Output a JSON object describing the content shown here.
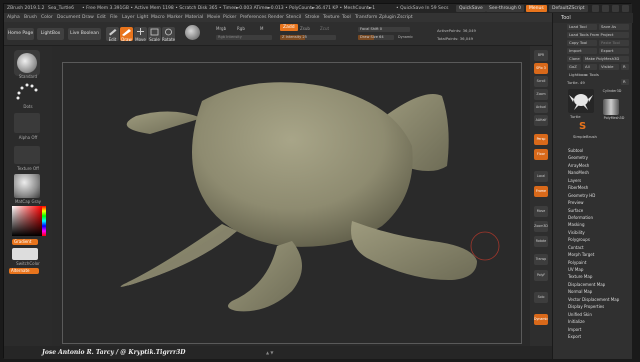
{
  "titlebar": {
    "app": "ZBrush 2019.1.2",
    "doc": "Sea_Turtle6",
    "stats": "• Free Mem 3.391GB • Active Mem 1198 • Scratch Disk 365 • Timer►0.003 ATime►0.013 • PolyCount►36.471 KP • MeshCount►1",
    "quicksave_info": "• QuickSave In 59 Secs",
    "quicksave": "QuickSave",
    "seethrough": "See-through 0",
    "menus": "Menus",
    "script": "DefaultZScript"
  },
  "menubar": [
    "Alpha",
    "Brush",
    "Color",
    "Document",
    "Draw",
    "Edit",
    "File",
    "Layer",
    "Light",
    "Macro",
    "Marker",
    "Material",
    "Movie",
    "Picker",
    "Preferences",
    "Render",
    "Stencil",
    "Stroke",
    "Texture",
    "Tool",
    "Transform",
    "Zplugin",
    "Zscript"
  ],
  "shelf": {
    "home_page": "Home Page",
    "lightbox": "LightBox",
    "live_boolean": "Live Boolean",
    "edit": "Edit",
    "draw": "Draw",
    "move": "Move",
    "scale": "Scale",
    "rotate": "Rotate",
    "mrgb": "Mrgb",
    "rgb": "Rgb",
    "m": "M",
    "zadd": "Zadd",
    "zsub": "Zsub",
    "zcut": "Zcut",
    "rgb_intensity": "Rgb Intensity",
    "z_intensity": "Z Intensity 25",
    "focal_shift": "Focal Shift 0",
    "draw_size": "Draw Size 64",
    "dynamic": "Dynamic",
    "active_points": "ActivePoints: 36,049",
    "total_points": "TotalPoints: 36,049"
  },
  "left_tray": {
    "standard": "Standard",
    "dots": "Dots",
    "alpha_off": "Alpha Off",
    "texture_off": "Texture Off",
    "matcap": "MatCap Gray",
    "gradient": "Gradient",
    "switch_color": "SwitchColor",
    "alternate": "Alternate"
  },
  "right_tray": [
    "BPR",
    "SPix 3",
    "Scroll",
    "Zoom",
    "Actual",
    "AAHalf",
    "Persp",
    "Floor",
    "Local",
    "Frame",
    "Move",
    "Zoom3D",
    "Rotate",
    "Transp",
    "PolyF",
    "Solo",
    "Dynamic"
  ],
  "palette": {
    "title": "Tool",
    "load_tool": "Load Tool",
    "save_as": "Save As",
    "load_from_project": "Load Tools From Project",
    "copy_tool": "Copy Tool",
    "paste_tool": "Paste Tool",
    "import": "Import",
    "export": "Export",
    "clone": "Clone",
    "make_polymesh": "Make PolyMesh3D",
    "goz": "GoZ",
    "all": "All",
    "visible": "Visible",
    "r": "R",
    "lightbox_tools": "Lightbox► Tools",
    "turtle_label": "Turtle. 49",
    "turtle": "Turtle",
    "cylinder": "Cylinder3D",
    "polymesh": "PolyMesh3D",
    "simplebrush": "SimpleBrush",
    "r_btn": "R",
    "subpanels": [
      "Subtool",
      "Geometry",
      "ArrayMesh",
      "NanoMesh",
      "Layers",
      "FiberMesh",
      "Geometry HD",
      "Preview",
      "Surface",
      "Deformation",
      "Masking",
      "Visibility",
      "Polygroups",
      "Contact",
      "Morph Target",
      "Polypaint",
      "UV Map",
      "Texture Map",
      "Displacement Map",
      "Normal Map",
      "Vector Displacement Map",
      "Display Properties",
      "Unified Skin",
      "Initialize",
      "Import",
      "Export"
    ]
  },
  "footer": {
    "credit": "Jose Antonio R. Tarcy / @ Kryptik.Tigrrr3D"
  },
  "colors": {
    "accent": "#e8741c",
    "turtle": "#8e8b70",
    "background": "#2a2a2a"
  }
}
